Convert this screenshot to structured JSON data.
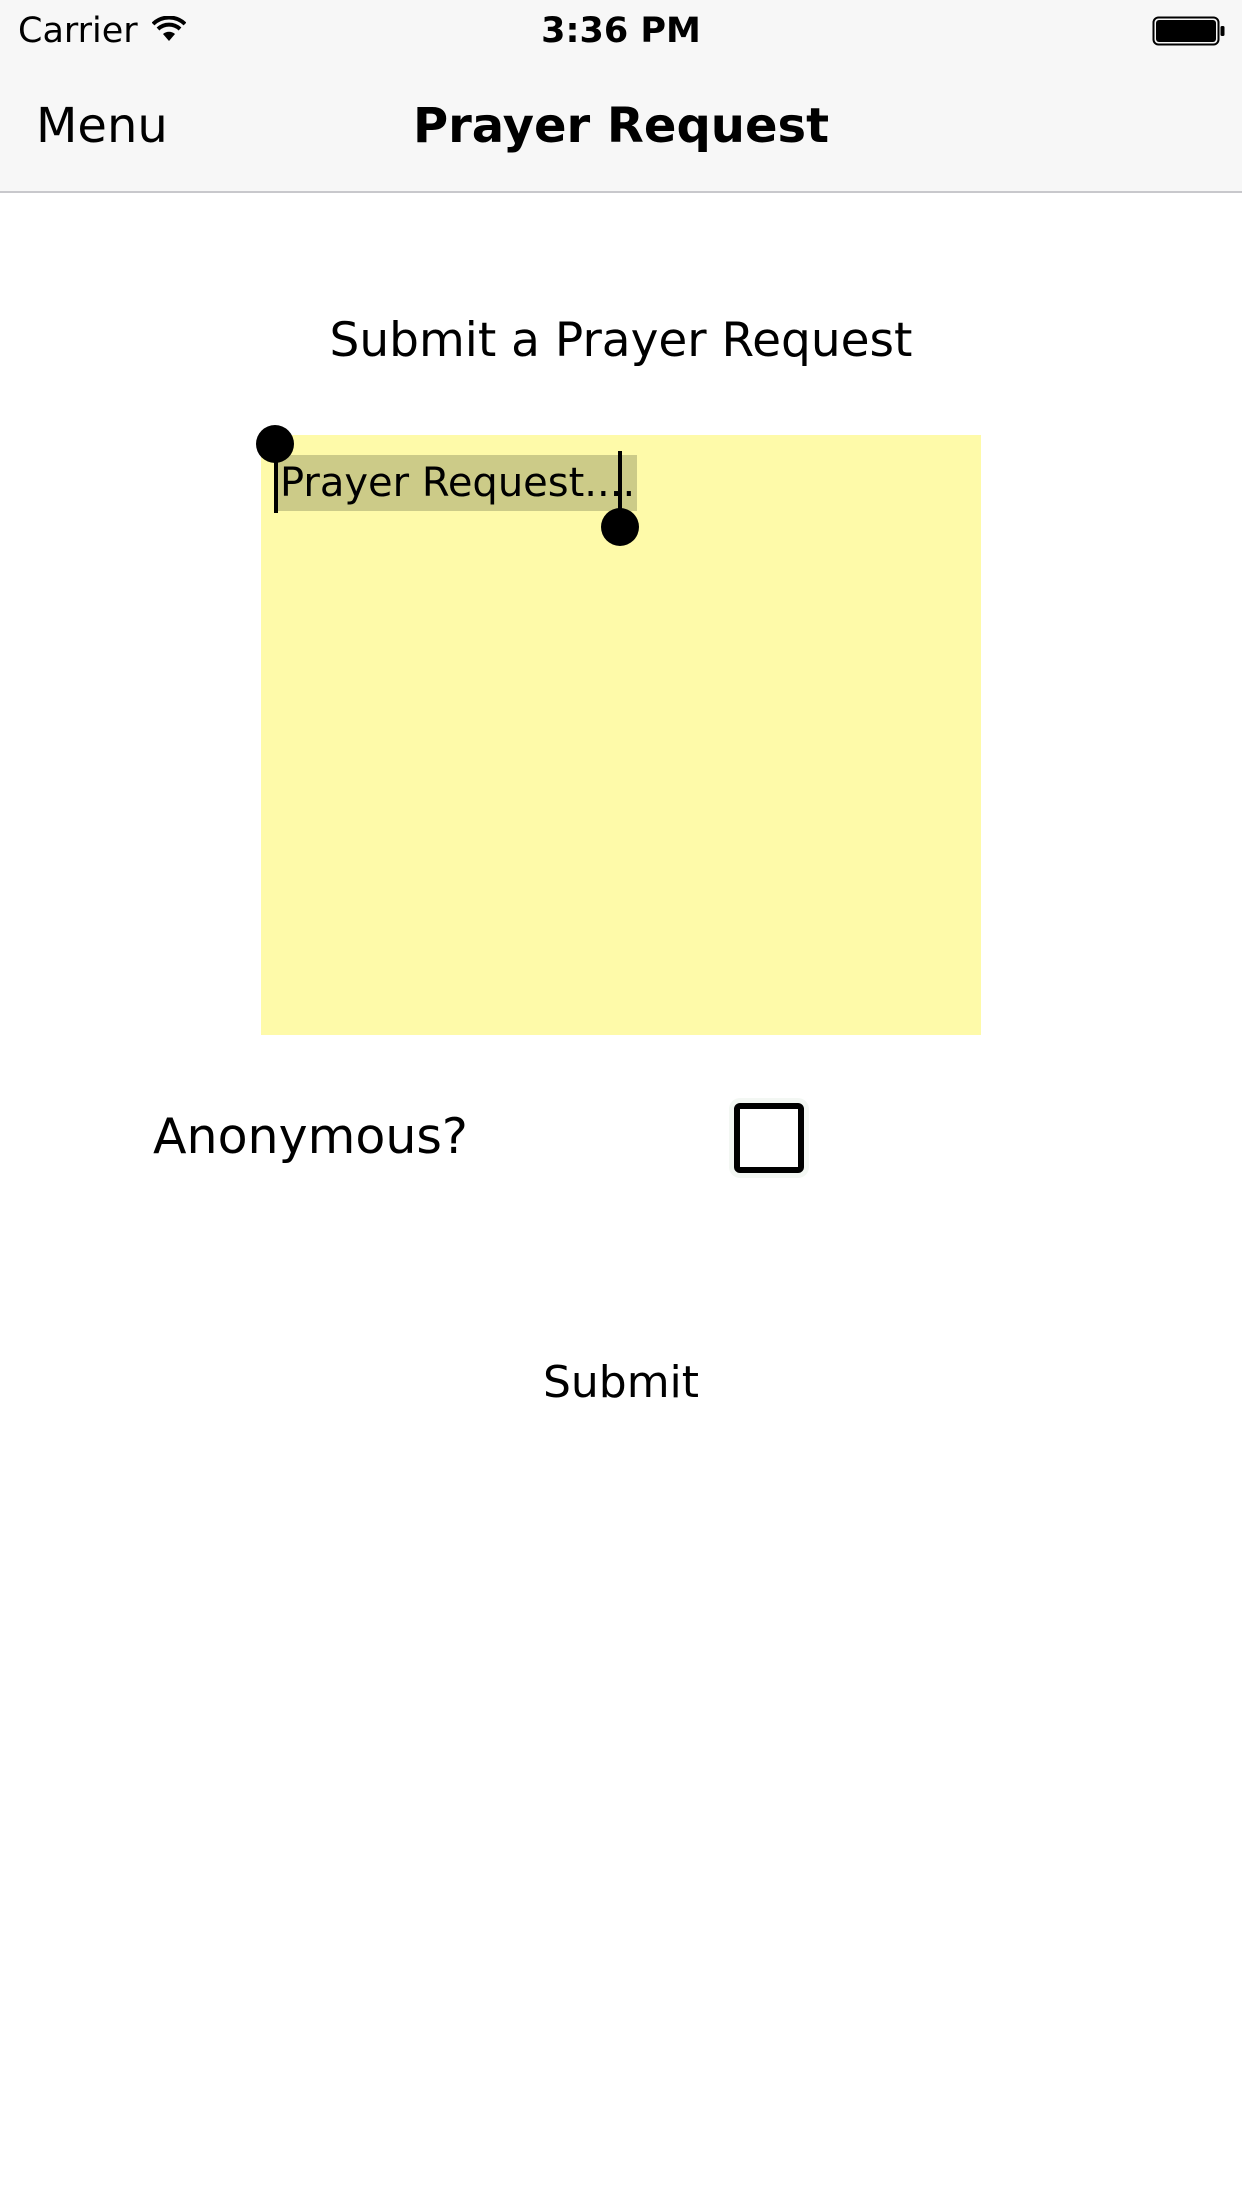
{
  "status_bar": {
    "carrier": "Carrier",
    "time": "3:36 PM",
    "icons": [
      "wifi-icon",
      "battery-icon"
    ]
  },
  "nav": {
    "menu_label": "Menu",
    "title": "Prayer Request"
  },
  "form": {
    "heading": "Submit a Prayer Request",
    "request_text": "Prayer Request....",
    "anonymous_label": "Anonymous?",
    "anonymous_checked": false,
    "submit_label": "Submit"
  },
  "colors": {
    "note_background": "#fefaa9",
    "selection_highlight": "#cccb88",
    "bar_background": "#f7f7f7"
  }
}
